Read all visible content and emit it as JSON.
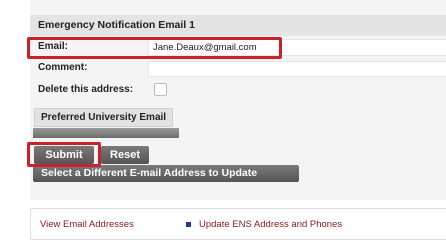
{
  "form": {
    "title": "Emergency Notification Email 1",
    "email_label": "Email:",
    "email_value": "Jane.Deaux@gmail.com",
    "comment_label": "Comment:",
    "comment_value": "",
    "delete_label": "Delete this address:",
    "delete_checked": false,
    "preferred_label": "Preferred University Email"
  },
  "buttons": {
    "submit": "Submit",
    "reset": "Reset",
    "select_different": "Select a Different E-mail Address to Update"
  },
  "links": {
    "view": "View Email Addresses",
    "update_ens": "Update ENS Address and Phones"
  },
  "colors": {
    "highlight": "#c9222d",
    "link": "#8b1a1a",
    "separator": "#1f3c8a"
  }
}
